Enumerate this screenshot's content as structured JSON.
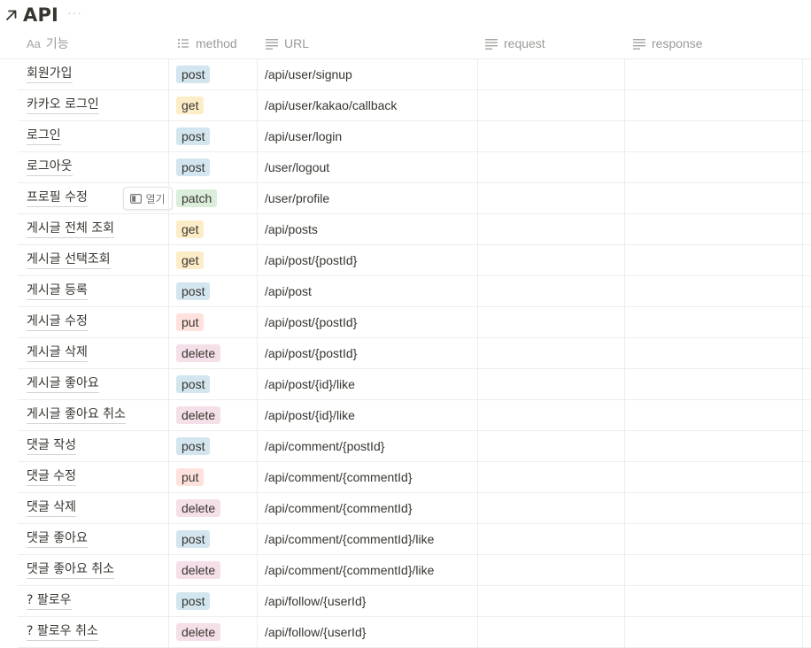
{
  "page": {
    "title": "API",
    "more_label": "···"
  },
  "columns": {
    "name": {
      "label": "기능",
      "prefix": "Aa"
    },
    "method": {
      "label": "method"
    },
    "url": {
      "label": "URL"
    },
    "request": {
      "label": "request"
    },
    "response": {
      "label": "response"
    }
  },
  "open_button_label": "열기",
  "method_colors": {
    "post": "#d3e5ef",
    "get": "#fdecc8",
    "patch": "#dbeddb",
    "put": "#ffe2dd",
    "delete": "#f5e0e9"
  },
  "rows": [
    {
      "name": "회원가입",
      "method": "post",
      "url": "/api/user/signup"
    },
    {
      "name": "카카오 로그인",
      "method": "get",
      "url": "/api/user/kakao/callback"
    },
    {
      "name": "로그인",
      "method": "post",
      "url": "/api/user/login"
    },
    {
      "name": "로그아웃",
      "method": "post",
      "url": "/user/logout"
    },
    {
      "name": "프로필 수정",
      "method": "patch",
      "url": "/user/profile",
      "hovered": true
    },
    {
      "name": "게시글 전체 조회",
      "method": "get",
      "url": "/api/posts"
    },
    {
      "name": "게시글 선택조회",
      "method": "get",
      "url": "/api/post/{postId}"
    },
    {
      "name": "게시글 등록",
      "method": "post",
      "url": "/api/post"
    },
    {
      "name": "게시글 수정",
      "method": "put",
      "url": "/api/post/{postId}"
    },
    {
      "name": "게시글 삭제",
      "method": "delete",
      "url": "/api/post/{postId}"
    },
    {
      "name": "게시글 좋아요",
      "method": "post",
      "url": "/api/post/{id}/like"
    },
    {
      "name": "게시글 좋아요 취소",
      "method": "delete",
      "url": "/api/post/{id}/like"
    },
    {
      "name": "댓글 작성",
      "method": "post",
      "url": "/api/comment/{postId}"
    },
    {
      "name": "댓글 수정",
      "method": "put",
      "url": "/api/comment/{commentId}"
    },
    {
      "name": "댓글 삭제",
      "method": "delete",
      "url": "/api/comment/{commentId}"
    },
    {
      "name": "댓글 좋아요",
      "method": "post",
      "url": "/api/comment/{commentId}/like"
    },
    {
      "name": "댓글 좋아요 취소",
      "method": "delete",
      "url": "/api/comment/{commentId}/like"
    },
    {
      "name": "? 팔로우",
      "method": "post",
      "url": "/api/follow/{userId}"
    },
    {
      "name": "? 팔로우 취소",
      "method": "delete",
      "url": "/api/follow/{userId}"
    }
  ]
}
